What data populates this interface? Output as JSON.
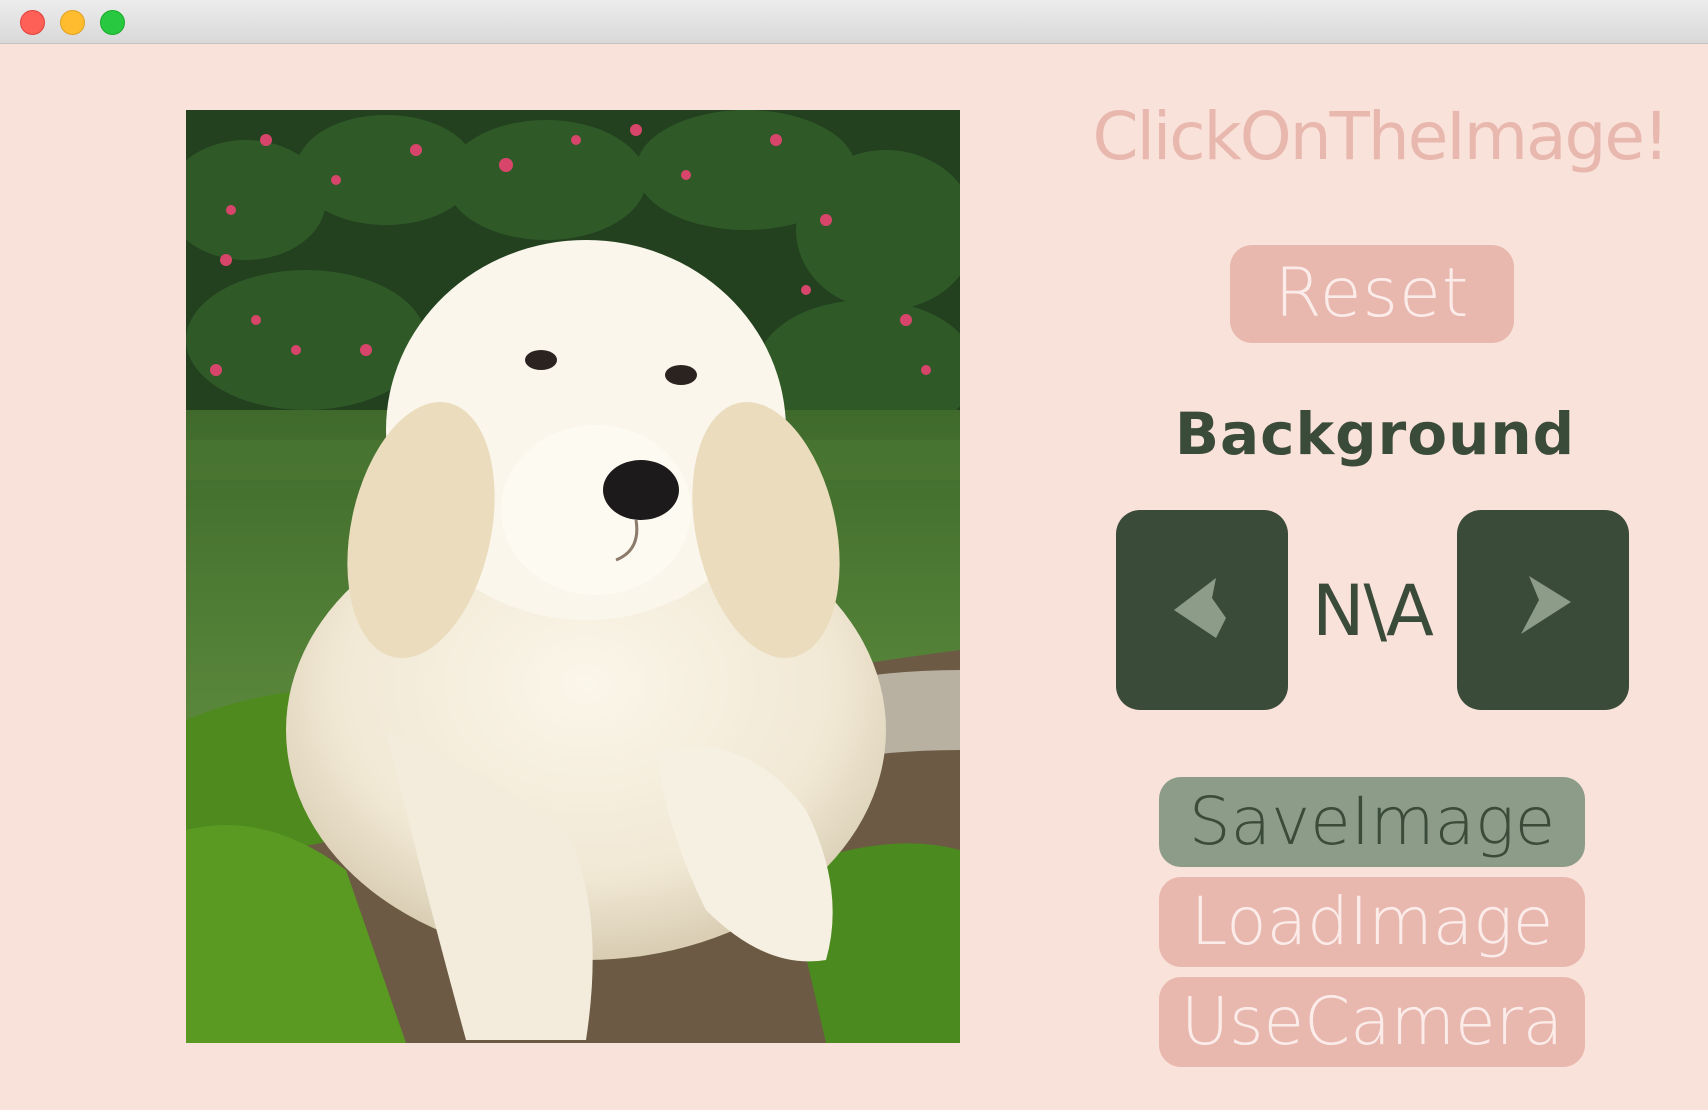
{
  "window": {
    "background_color": "#f9e2d9"
  },
  "header": {
    "title": "ClickOnTheImage!"
  },
  "photo": {
    "subject_icon": "puppy-photo"
  },
  "controls": {
    "reset_label": "Reset",
    "background_label": "Background",
    "background_value": "N\\A",
    "prev_icon": "chevron-left-icon",
    "next_icon": "chevron-right-icon",
    "save_label": "SaveImage",
    "load_label": "LoadImage",
    "camera_label": "UseCamera"
  },
  "colors": {
    "pink": "#e8b7ae",
    "dark_green": "#3b4b3a",
    "sage": "#8c9c88",
    "light_text": "#fbecea"
  }
}
